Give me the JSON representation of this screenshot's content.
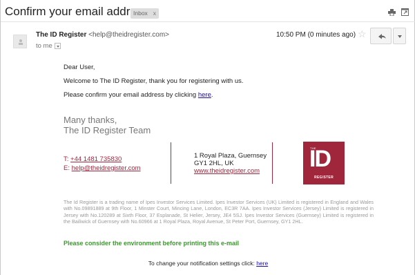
{
  "header": {
    "subject": "Confirm your email address",
    "label_tag": "Inbox",
    "label_close": "x",
    "icons": [
      "print-icon",
      "new-window-icon"
    ]
  },
  "message": {
    "sender_name": "The ID Register",
    "sender_email": "<help@theidregister.com>",
    "to": "to me",
    "time": "10:50 PM (0 minutes ago)",
    "star": "☆"
  },
  "body": {
    "greeting": "Dear User,",
    "welcome": "Welcome to The ID Register, thank you for registering with us.",
    "confirm_prefix": "Please confirm your email address by clicking",
    "confirm_link": "here",
    "confirm_suffix": ".",
    "thanks_line1": "Many thanks,",
    "thanks_line2": "The ID Register Team"
  },
  "signature": {
    "phone_label": "T:",
    "phone": "+44 1481 735830",
    "email_label": "E:",
    "email": "help@theidregister.com",
    "address_line1": "1 Royal Plaza, Guernsey",
    "address_line2": "GY1 2HL, UK",
    "website": "www.theidregister.com",
    "logo_top": "THE",
    "logo_main": "ID",
    "logo_bottom": "REGISTER",
    "brand_color": "#a0263c"
  },
  "legal": "The Id Register is a trading name of Ipes Investor Services Limited. Ipes Investor Services (UK) Limited is registered in England and Wales with No.09891889 at 9th Floor, 1 Minster Court, Mincing Lane, London, EC3R 7AA. Ipes Investor Services (Jersey) Limited is registered in Jersey with No.120289 at Sixth Floor, 37 Esplanade, St Helier, Jersey, JE4 5SJ. Ipes Investor Services (Guernsey) Limited is registered in the Bailiwick of Guernsey with No.60966 at 1 Royal Plaza, Royal Avenue, St Peter Port, Guernsey, GY1 2HL.",
  "environment_note": "Please consider the environment before printing this e-mail",
  "footer": {
    "notify_prefix": "To change your notification settings click:",
    "notify_link": "here"
  }
}
